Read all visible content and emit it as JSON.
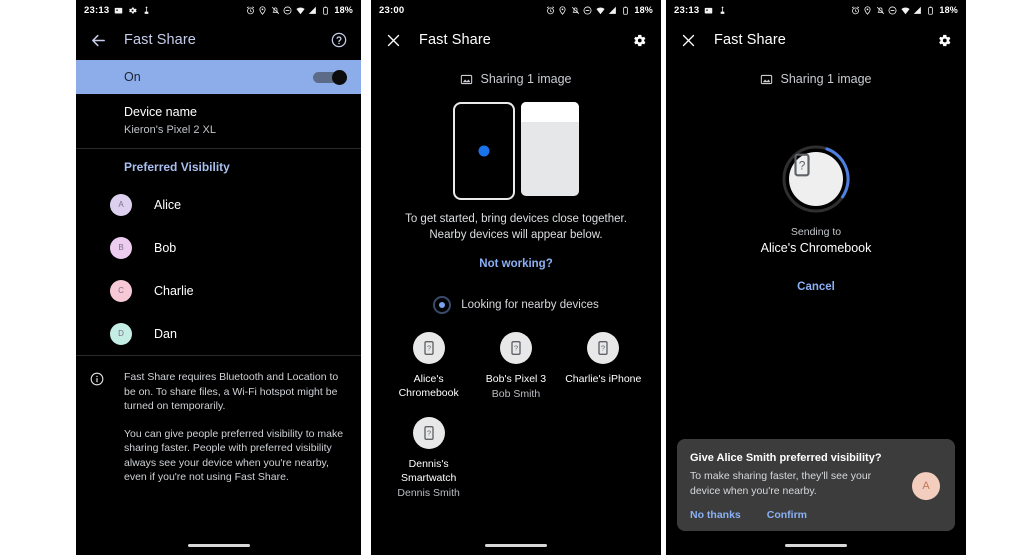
{
  "panels": {
    "settings": {
      "status_bar": {
        "time": "23:13",
        "left_icons": [
          "screenshot-icon",
          "gear-icon",
          "usb-icon"
        ],
        "right_icons": [
          "alarm-icon",
          "location-icon",
          "bell-muted-icon",
          "do-not-disturb-icon",
          "wifi-icon",
          "cellular-icon",
          "battery-icon"
        ],
        "battery_pct": "18%"
      },
      "app_bar": {
        "back_icon": "back-arrow-icon",
        "title": "Fast Share",
        "end_icon": "help-icon"
      },
      "toggle_row": {
        "label": "On",
        "state": "on"
      },
      "device_name": {
        "title": "Device name",
        "value": "Kieron's Pixel 2 XL"
      },
      "section_title": "Preferred Visibility",
      "contacts": [
        {
          "initial": "A",
          "name": "Alice",
          "color": "#ddd0ef"
        },
        {
          "initial": "B",
          "name": "Bob",
          "color": "#eccdf0"
        },
        {
          "initial": "C",
          "name": "Charlie",
          "color": "#f7c9d6"
        },
        {
          "initial": "D",
          "name": "Dan",
          "color": "#c4eee4"
        }
      ],
      "info_icon": "info-icon",
      "info_paragraphs": [
        "Fast Share requires Bluetooth and Location to be on. To share files, a Wi-Fi hotspot might be turned on temporarily.",
        "You can give people preferred visibility to make sharing faster. People with preferred visibility always see your device when you're nearby, even if you're not using Fast Share."
      ]
    },
    "discovery": {
      "status_bar": {
        "time": "23:00",
        "left_icons": [],
        "right_icons": [
          "alarm-icon",
          "location-icon",
          "bell-muted-icon",
          "do-not-disturb-icon",
          "wifi-icon",
          "cellular-icon",
          "battery-icon"
        ],
        "battery_pct": "18%"
      },
      "app_bar": {
        "close_icon": "close-icon",
        "title": "Fast Share",
        "end_icon": "gear-icon"
      },
      "sharing_label": "Sharing 1 image",
      "sharing_icon": "image-icon",
      "instructions_line1": "To get started, bring devices close together.",
      "instructions_line2": "Nearby devices will appear below.",
      "not_working_label": "Not working?",
      "looking_label": "Looking for nearby devices",
      "looking_icon": "radio-selected-icon",
      "devices": [
        {
          "icon": "unknown-device-icon",
          "name": "Alice's Chromebook",
          "owner": ""
        },
        {
          "icon": "unknown-device-icon",
          "name": "Bob's Pixel 3",
          "owner": "Bob Smith"
        },
        {
          "icon": "unknown-device-icon",
          "name": "Charlie's iPhone",
          "owner": ""
        },
        {
          "icon": "unknown-device-icon",
          "name": "Dennis's Smartwatch",
          "owner": "Dennis Smith"
        }
      ]
    },
    "sending": {
      "status_bar": {
        "time": "23:13",
        "left_icons": [
          "screenshot-icon",
          "usb-icon"
        ],
        "right_icons": [
          "alarm-icon",
          "location-icon",
          "bell-muted-icon",
          "do-not-disturb-icon",
          "wifi-icon",
          "cellular-icon",
          "battery-icon"
        ],
        "battery_pct": "18%"
      },
      "app_bar": {
        "close_icon": "close-icon",
        "title": "Fast Share",
        "end_icon": "gear-icon"
      },
      "sharing_label": "Sharing 1 image",
      "sharing_icon": "image-icon",
      "target_icon": "unknown-device-icon",
      "sending_to_label": "Sending to",
      "target_device": "Alice's Chromebook",
      "cancel_label": "Cancel",
      "snackbar": {
        "title": "Give Alice Smith preferred visibility?",
        "body": "To make sharing faster, they'll see your device when you're nearby.",
        "decline_label": "No thanks",
        "confirm_label": "Confirm",
        "avatar_initial": "A",
        "avatar_color": "#f3cdbd"
      }
    }
  },
  "theme": {
    "accent_blue": "#8ab0f5",
    "toggle_band": "#8cadea",
    "dot_blue": "#1a73e8",
    "surface": "#000000",
    "snackbar_bg": "#3c3c3c"
  }
}
